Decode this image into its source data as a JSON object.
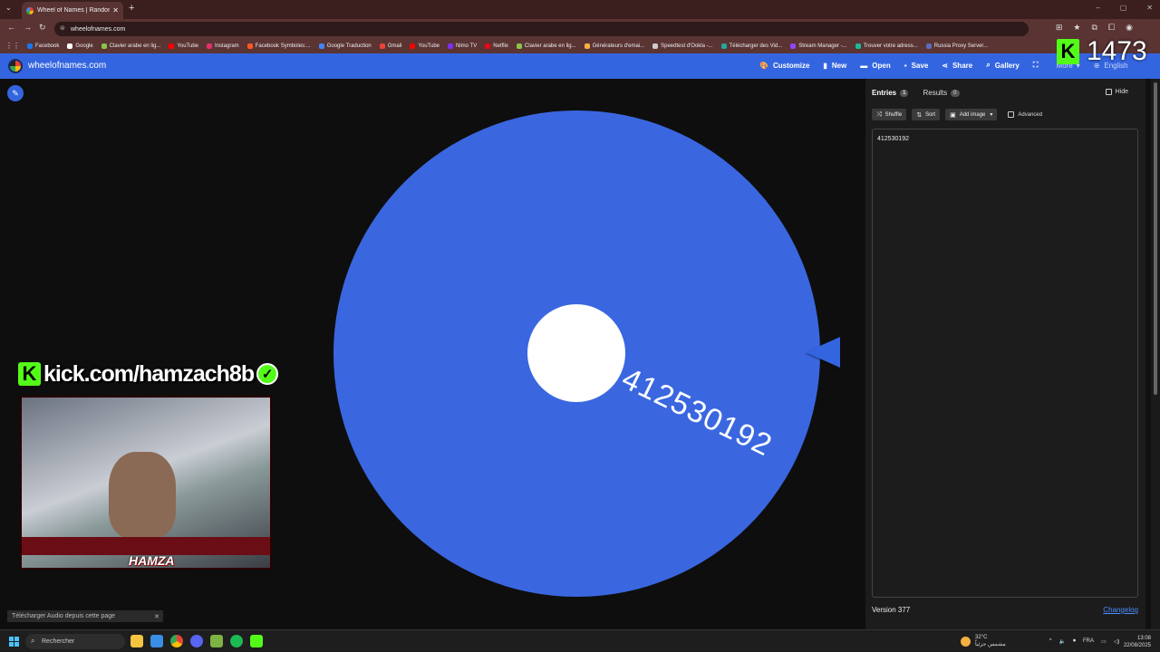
{
  "browser": {
    "tab_title": "Wheel of Names | Random nam",
    "url": "wheelofnames.com",
    "bookmarks": [
      {
        "label": "Facebook",
        "color": "#1877f2"
      },
      {
        "label": "Google",
        "color": "#ffffff"
      },
      {
        "label": "Clavier arabe en lig...",
        "color": "#8bc34a"
      },
      {
        "label": "YouTube",
        "color": "#ff0000"
      },
      {
        "label": "Instagram",
        "color": "#e1306c"
      },
      {
        "label": "Facebook Symboles:...",
        "color": "#ff5722"
      },
      {
        "label": "Google Traduction",
        "color": "#4285f4"
      },
      {
        "label": "Gmail",
        "color": "#ea4335"
      },
      {
        "label": "YouTube",
        "color": "#ff0000"
      },
      {
        "label": "Nimo TV",
        "color": "#7b2ff7"
      },
      {
        "label": "Netflix",
        "color": "#e50914"
      },
      {
        "label": "Clavier arabe en lig...",
        "color": "#8bc34a"
      },
      {
        "label": "Générateurs d'emai...",
        "color": "#f5b041"
      },
      {
        "label": "Speedtest d'Ookla -...",
        "color": "#cccccc"
      },
      {
        "label": "Télécharger des Vid...",
        "color": "#26a69a"
      },
      {
        "label": "Stream Manager -...",
        "color": "#9146ff"
      },
      {
        "label": "Trouver votre adress...",
        "color": "#1abc9c"
      },
      {
        "label": "Russia Proxy Server...",
        "color": "#5c6bc0"
      }
    ]
  },
  "app": {
    "site_name": "wheelofnames.com",
    "menu": [
      {
        "label": "Customize",
        "icon": "palette-icon",
        "glyph": "🎨"
      },
      {
        "label": "New",
        "icon": "new-file-icon",
        "glyph": "▮"
      },
      {
        "label": "Open",
        "icon": "folder-icon",
        "glyph": "▬"
      },
      {
        "label": "Save",
        "icon": "save-icon",
        "glyph": "▪"
      },
      {
        "label": "Share",
        "icon": "share-icon",
        "glyph": "⋖"
      },
      {
        "label": "Gallery",
        "icon": "search-icon",
        "glyph": "⌕"
      },
      {
        "label": "",
        "icon": "fullscreen-icon",
        "glyph": "⛶"
      },
      {
        "label": "More",
        "icon": "chevron-down-icon",
        "glyph": ""
      },
      {
        "label": "English",
        "icon": "globe-icon",
        "glyph": "⊕"
      }
    ]
  },
  "wheel": {
    "entry_label": "412530192",
    "color": "#3a67e0"
  },
  "panel": {
    "tabs": [
      {
        "label": "Entries",
        "count": "1"
      },
      {
        "label": "Results",
        "count": "0"
      }
    ],
    "hide_label": "Hide",
    "tools": {
      "shuffle": "Shuffle",
      "sort": "Sort",
      "add_image": "Add image",
      "advanced": "Advanced"
    },
    "entries_text": "412530192",
    "version": "Version 377",
    "changelog": "Changelog"
  },
  "overlay": {
    "kick_url": "kick.com/hamzach8b",
    "kick_logo": "K",
    "streamer_name": "HAMZA",
    "follower_count": "1473",
    "download_bar": "Télécharger Audio depuis cette page",
    "download_close": "✕"
  },
  "taskbar": {
    "search_placeholder": "Rechercher",
    "weather_temp": "32°C",
    "weather_desc": "مشمس جزئياً",
    "lang": "FRA",
    "time": "13:08",
    "date": "22/08/2025"
  }
}
